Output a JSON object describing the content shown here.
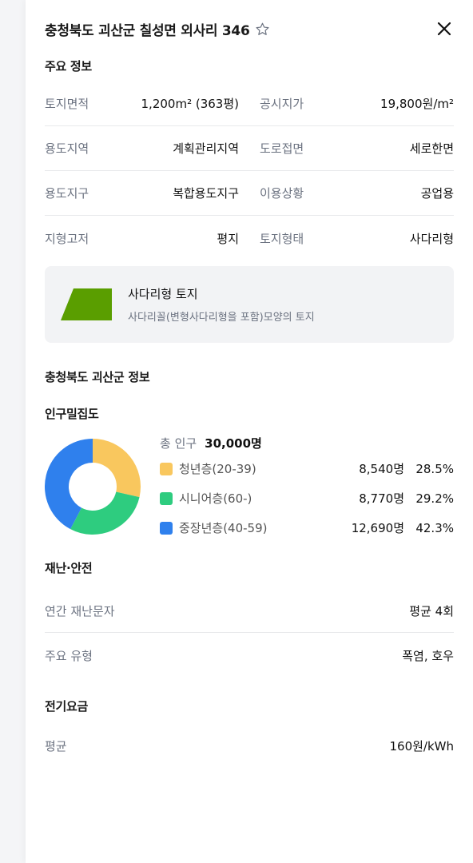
{
  "header": {
    "title": "충청북도 괴산군 칠성면 외사리 346",
    "star_icon": "star-outline-icon",
    "close_icon": "close-icon"
  },
  "main_info": {
    "section_title": "주요 정보",
    "rows": [
      [
        {
          "label": "토지면적",
          "value": "1,200m² (363평)"
        },
        {
          "label": "공시지가",
          "value": "19,800원/m²"
        }
      ],
      [
        {
          "label": "용도지역",
          "value": "계획관리지역"
        },
        {
          "label": "도로접면",
          "value": "세로한면"
        }
      ],
      [
        {
          "label": "용도지구",
          "value": "복합용도지구"
        },
        {
          "label": "이용상황",
          "value": "공업용"
        }
      ],
      [
        {
          "label": "지형고저",
          "value": "평지"
        },
        {
          "label": "토지형태",
          "value": "사다리형"
        }
      ]
    ]
  },
  "land_shape": {
    "icon": "trapezoid-shape-icon",
    "color": "#5a9e00",
    "title": "사다리형 토지",
    "description": "사다리꼴(변형사다리형을 포함)모양의 토지"
  },
  "region": {
    "section_title": "충청북도 괴산군 정보"
  },
  "population": {
    "section_title": "인구밀집도",
    "total_label": "총 인구",
    "total_value": "30,000명"
  },
  "chart_data": {
    "type": "pie",
    "donut": true,
    "categories": [
      "청년층(20-39)",
      "시니어층(60-)",
      "중장년층(40-59)"
    ],
    "counts": [
      "8,540명",
      "8,770명",
      "12,690명"
    ],
    "percents": [
      "28.5%",
      "29.2%",
      "42.3%"
    ],
    "values": [
      28.5,
      29.2,
      42.3
    ],
    "colors": [
      "#f9c75e",
      "#2ecc7f",
      "#2f80ed"
    ]
  },
  "safety": {
    "section_title": "재난·안전",
    "rows": [
      {
        "label": "연간 재난문자",
        "value": "평균 4회"
      },
      {
        "label": "주요 유형",
        "value": "폭염, 호우"
      }
    ]
  },
  "electricity": {
    "section_title": "전기요금",
    "label": "평균",
    "value": "160원/kWh"
  }
}
